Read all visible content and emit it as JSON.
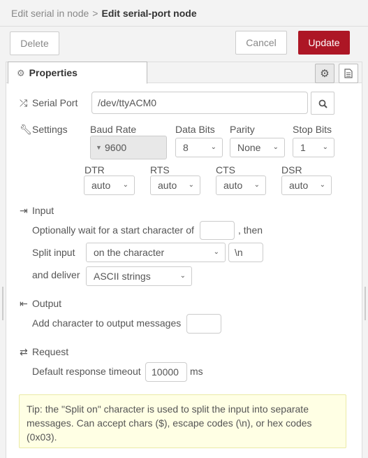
{
  "breadcrumb": {
    "parent": "Edit serial in node",
    "separator": ">",
    "current": "Edit serial-port node"
  },
  "buttons": {
    "delete": "Delete",
    "cancel": "Cancel",
    "update": "Update"
  },
  "colors": {
    "primary": "#ad1625",
    "tip_bg": "#ffffe4"
  },
  "tabs": {
    "properties": "Properties"
  },
  "serial_port": {
    "label": "Serial Port",
    "value": "/dev/ttyACM0",
    "icon": "shuffle-icon",
    "search_icon": "search-icon"
  },
  "settings": {
    "label": "Settings",
    "icon": "wrench-icon",
    "baud": {
      "label": "Baud Rate",
      "value": "9600"
    },
    "databits": {
      "label": "Data Bits",
      "value": "8"
    },
    "parity": {
      "label": "Parity",
      "value": "None"
    },
    "stopbits": {
      "label": "Stop Bits",
      "value": "1"
    },
    "dtr": {
      "label": "DTR",
      "value": "auto"
    },
    "rts": {
      "label": "RTS",
      "value": "auto"
    },
    "cts": {
      "label": "CTS",
      "value": "auto"
    },
    "dsr": {
      "label": "DSR",
      "value": "auto"
    }
  },
  "input": {
    "label": "Input",
    "icon": "sign-in-icon",
    "wait_label": "Optionally wait for a start character of",
    "wait_value": "",
    "then_label": ", then",
    "split_label": "Split input",
    "split_value": "on the character",
    "split_char": "\\n",
    "deliver_label": "and deliver",
    "deliver_value": "ASCII strings"
  },
  "output": {
    "label": "Output",
    "icon": "sign-out-icon",
    "add_label": "Add character to output messages",
    "add_value": ""
  },
  "request": {
    "label": "Request",
    "icon": "exchange-icon",
    "timeout_label": "Default response timeout",
    "timeout_value": "10000",
    "unit": "ms"
  },
  "tip": "Tip: the \"Split on\" character is used to split the input into separate messages. Can accept chars ($), escape codes (\\n), or hex codes (0x03)."
}
